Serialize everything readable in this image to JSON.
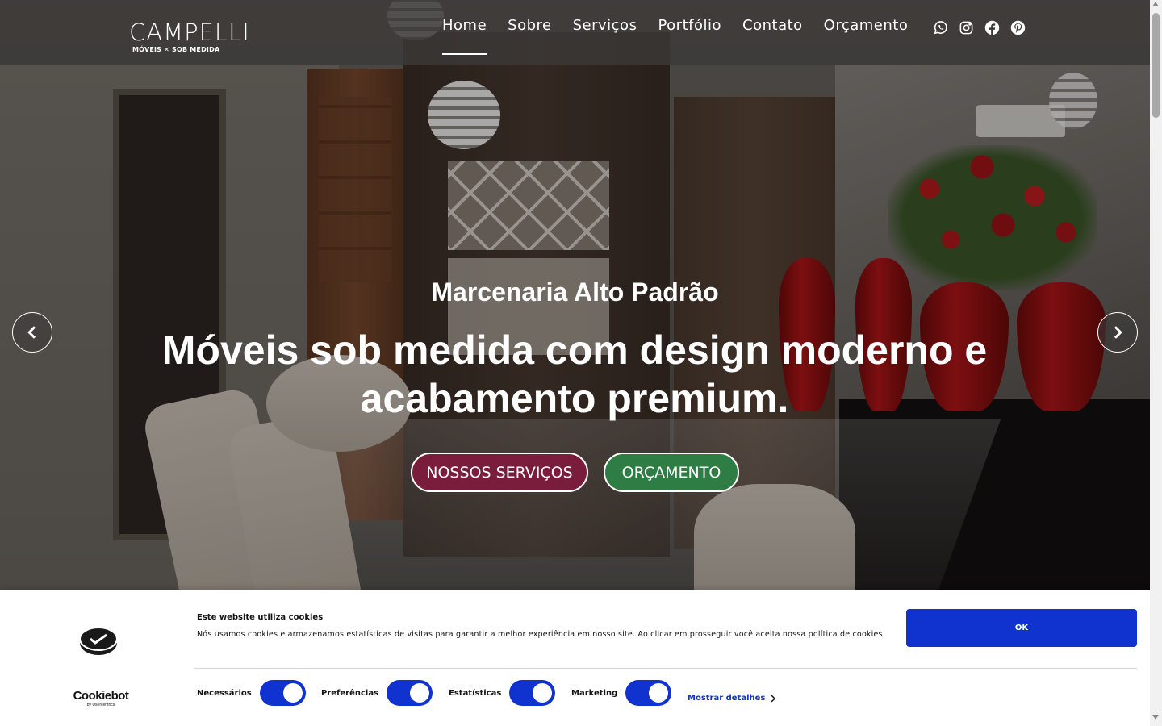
{
  "brand": {
    "logo_word": "CAMPELLI",
    "logo_sub": "MÓVEIS ✕ SOB MEDIDA"
  },
  "nav": {
    "items": [
      {
        "label": "Home",
        "active": true
      },
      {
        "label": "Sobre",
        "active": false
      },
      {
        "label": "Serviços",
        "active": false
      },
      {
        "label": "Portfólio",
        "active": false
      },
      {
        "label": "Contato",
        "active": false
      },
      {
        "label": "Orçamento",
        "active": false
      }
    ],
    "social_icons": [
      "whatsapp-icon",
      "instagram-icon",
      "facebook-icon",
      "pinterest-icon"
    ]
  },
  "hero": {
    "kicker": "Marcenaria Alto Padrão",
    "title": "Móveis sob medida com design moderno e acabamento premium.",
    "btn_services": "NOSSOS SERVIÇOS",
    "btn_quote": "ORÇAMENTO",
    "prev_icon": "chevron-left-icon",
    "next_icon": "chevron-right-icon"
  },
  "cookie": {
    "brand_name": "Cookiebot",
    "brand_by": "by Usercentrics",
    "title": "Este website utiliza cookies",
    "text": "Nós usamos cookies e armazenamos estatísticas de visitas para garantir a melhor experiência em nosso site. Ao clicar em prosseguir você aceita nossa política de cookies.",
    "ok_label": "OK",
    "toggles": [
      {
        "label": "Necessários",
        "checked": true
      },
      {
        "label": "Preferências",
        "checked": true
      },
      {
        "label": "Estatísticas",
        "checked": true
      },
      {
        "label": "Marketing",
        "checked": true
      }
    ],
    "details_label": "Mostrar detalhes"
  },
  "colors": {
    "navbar_bg": "#3c3a38",
    "btn_services_bg": "#7a1d3c",
    "btn_quote_bg": "#2e7d45",
    "cookie_accent": "#1032cf"
  }
}
